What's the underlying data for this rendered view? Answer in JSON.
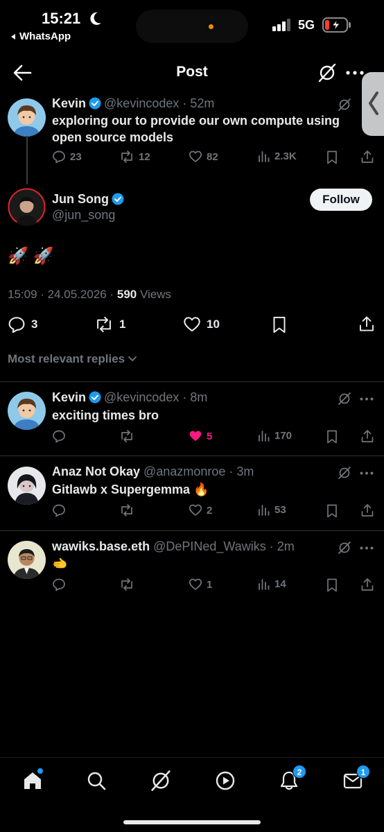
{
  "status_bar": {
    "time": "15:21",
    "back_app": "WhatsApp",
    "network": "5G"
  },
  "header": {
    "title": "Post"
  },
  "parent_post": {
    "name": "Kevin",
    "handle": "@kevincodex",
    "age": "52m",
    "text": "exploring our to provide our own compute using open source models",
    "replies": "23",
    "reposts": "12",
    "likes": "82",
    "views": "2.3K"
  },
  "main_post": {
    "name": "Jun Song",
    "handle": "@jun_song",
    "follow_label": "Follow",
    "content": "🚀 🚀",
    "time": "15:09",
    "date": "24.05.2026",
    "views_count": "590",
    "views_label": "Views",
    "replies": "3",
    "reposts": "1",
    "likes": "10"
  },
  "replies_sort": {
    "label": "Most relevant replies"
  },
  "replies": [
    {
      "name": "Kevin",
      "handle": "@kevincodex",
      "age": "8m",
      "text": "exciting times bro",
      "likes": "5",
      "views": "170",
      "liked": true
    },
    {
      "name": "Anaz Not Okay",
      "handle": "@anazmonroe",
      "age": "3m",
      "text": "Gitlawb x Supergemma 🔥",
      "likes": "2",
      "views": "53",
      "liked": false
    },
    {
      "name": "wawiks.base.eth",
      "handle": "@DePINed_Wawiks",
      "age": "2m",
      "text": "🫲",
      "likes": "1",
      "views": "14",
      "liked": false
    }
  ],
  "tab_bar": {
    "notifications_badge": "2",
    "messages_badge": "1"
  },
  "colors": {
    "accent": "#1d9bf0",
    "like_active": "#f91880",
    "background": "#000000",
    "muted": "#71767b"
  }
}
